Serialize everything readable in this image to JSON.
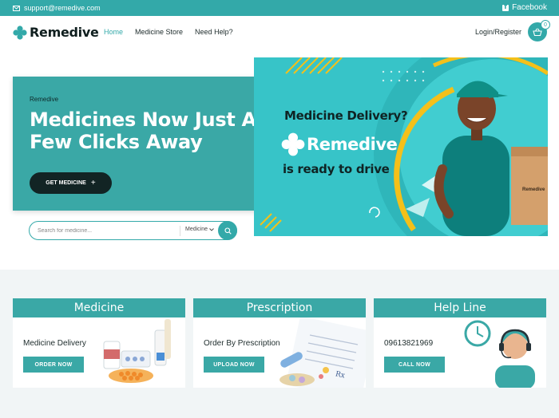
{
  "topbar": {
    "email": "support@remedive.com",
    "social": "Facebook"
  },
  "header": {
    "brand": "Remedive",
    "nav": [
      {
        "label": "Home",
        "active": true
      },
      {
        "label": "Medicine Store",
        "active": false
      },
      {
        "label": "Need Help?",
        "active": false
      }
    ],
    "login": "Login/Register",
    "cart_count": "0"
  },
  "hero": {
    "eyebrow": "Remedive",
    "title": "Medicines Now Just A Few Clicks Away",
    "cta": "GET MEDICINE"
  },
  "search": {
    "placeholder": "Search for medicine...",
    "category": "Medicine"
  },
  "banner": {
    "line1": "Medicine Delivery?",
    "brand": "Remedive",
    "line3": "is ready to drive",
    "box_label": "Remedive"
  },
  "services": [
    {
      "heading": "Medicine",
      "text": "Medicine Delivery",
      "button": "ORDER NOW"
    },
    {
      "heading": "Prescription",
      "text": "Order By Prescription",
      "button": "UPLOAD NOW"
    },
    {
      "heading": "Help Line",
      "text": "09613821969",
      "button": "CALL NOW"
    }
  ],
  "colors": {
    "primary": "#33a9a9",
    "dark": "#122424",
    "section_bg": "#f1f5f6"
  }
}
